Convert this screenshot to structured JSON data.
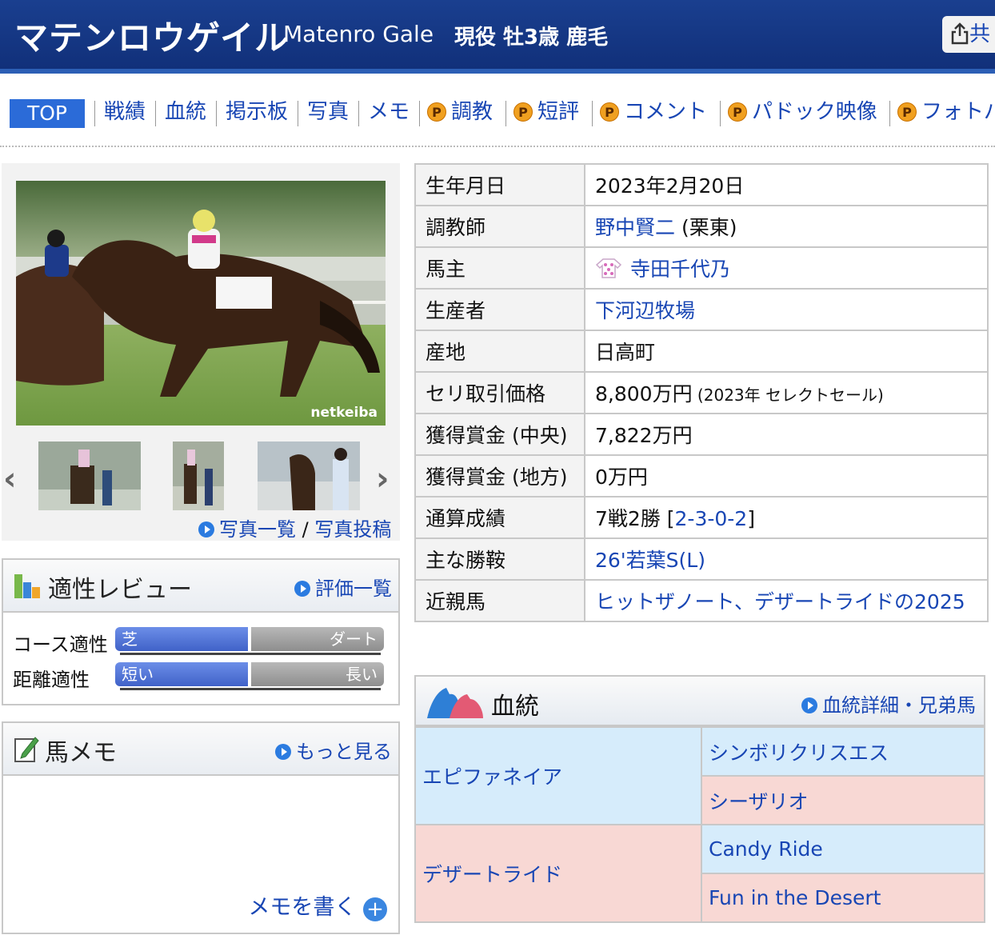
{
  "header": {
    "name_ja": "マテンロウゲイル",
    "name_en": "Matenro Gale",
    "status": "現役 牡3歳 鹿毛",
    "share_label": "共"
  },
  "nav": {
    "items": [
      {
        "label": "TOP",
        "premium": false
      },
      {
        "label": "戦績",
        "premium": false
      },
      {
        "label": "血統",
        "premium": false
      },
      {
        "label": "掲示板",
        "premium": false
      },
      {
        "label": "写真",
        "premium": false
      },
      {
        "label": "メモ",
        "premium": false
      },
      {
        "label": "調教",
        "premium": true
      },
      {
        "label": "短評",
        "premium": true
      },
      {
        "label": "コメント",
        "premium": true
      },
      {
        "label": "パドック映像",
        "premium": true
      },
      {
        "label": "フォトパ",
        "premium": true
      }
    ],
    "premium_badge": "P"
  },
  "photos": {
    "watermark": "netkeiba",
    "list_link": "写真一覧",
    "separator": "/",
    "post_link": "写真投稿"
  },
  "aptitude": {
    "title": "適性レビュー",
    "link": "評価一覧",
    "rows": [
      {
        "label": "コース適性",
        "left": "芝",
        "right": "ダート",
        "level": 0.5
      },
      {
        "label": "距離適性",
        "left": "短い",
        "right": "長い",
        "level": 0.5
      }
    ]
  },
  "memo": {
    "title": "馬メモ",
    "link": "もっと見る",
    "write": "メモを書く"
  },
  "info": {
    "rows": [
      {
        "key": "生年月日",
        "value": "2023年2月20日"
      },
      {
        "key": "調教師",
        "value_link": "野中賢二",
        "value_suffix": " (栗東)"
      },
      {
        "key": "馬主",
        "value_link": "寺田千代乃"
      },
      {
        "key": "生産者",
        "value_link": "下河辺牧場"
      },
      {
        "key": "産地",
        "value": "日高町"
      },
      {
        "key": "セリ取引価格",
        "value": "8,800万円",
        "value_note": " (2023年 セレクトセール)"
      },
      {
        "key": "獲得賞金 (中央)",
        "value": "7,822万円"
      },
      {
        "key": "獲得賞金 (地方)",
        "value": "0万円"
      },
      {
        "key": "通算成績",
        "value": "7戦2勝 [",
        "value_link": "2-3-0-2",
        "value_suffix": "]"
      },
      {
        "key": "主な勝鞍",
        "value_link": "26'若葉S(L)"
      },
      {
        "key": "近親馬",
        "value_link": "ヒットザノート、デザートライドの2025"
      }
    ]
  },
  "pedigree": {
    "title": "血統",
    "link": "血統詳細・兄弟馬",
    "sire": "エピファネイア",
    "sire_sire": "シンボリクリスエス",
    "sire_dam": "シーザリオ",
    "dam": "デザートライド",
    "dam_sire": "Candy Ride",
    "dam_dam": "Fun in the Desert"
  }
}
